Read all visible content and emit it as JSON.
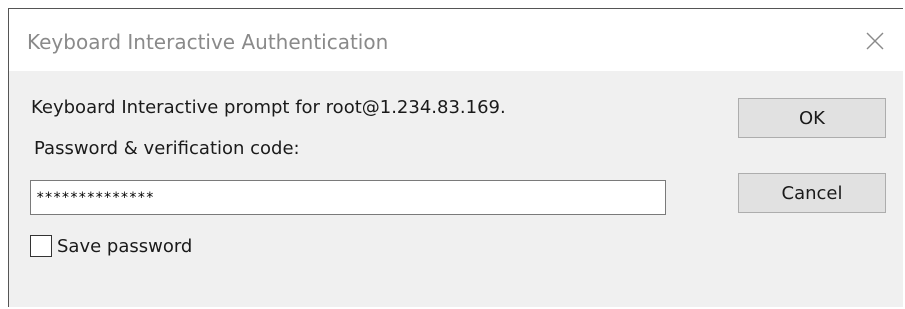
{
  "window": {
    "title": "Keyboard Interactive Authentication"
  },
  "body": {
    "prompt": "Keyboard Interactive prompt for root@1.234.83.169.",
    "field_label": "Password & verification code:",
    "password_value": "**************",
    "save_password_label": "Save password",
    "save_password_checked": false
  },
  "buttons": {
    "ok_label": "OK",
    "cancel_label": "Cancel"
  },
  "icons": {
    "close": "close-icon"
  }
}
